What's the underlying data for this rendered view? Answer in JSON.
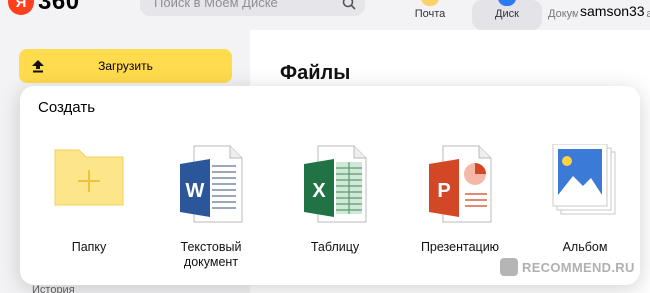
{
  "header": {
    "logo_text": "360",
    "logo_badge": "Я",
    "search_placeholder": "Поиск в Моем Диске",
    "services": [
      {
        "label": "Почта",
        "icon": "mail-icon"
      },
      {
        "label": "Диск",
        "icon": "disk-icon",
        "active": true
      },
      {
        "label": "Документы",
        "icon": "docs-icon"
      },
      {
        "label": "Ка",
        "icon": "more-icon"
      }
    ],
    "username": "samson33"
  },
  "sidebar": {
    "upload_label": "Загрузить",
    "history_label": "История"
  },
  "main": {
    "title": "Файлы"
  },
  "create_popup": {
    "title": "Создать",
    "items": [
      {
        "label": "Папку",
        "icon": "folder-icon"
      },
      {
        "label": "Текстовый документ",
        "icon": "word-document-icon"
      },
      {
        "label": "Таблицу",
        "icon": "excel-spreadsheet-icon"
      },
      {
        "label": "Презентацию",
        "icon": "powerpoint-presentation-icon"
      },
      {
        "label": "Альбом",
        "icon": "album-icon"
      }
    ]
  },
  "colors": {
    "accent_yellow": "#ffdb4d",
    "brand_red": "#fc3f1d",
    "disk_blue": "#2c7af0",
    "word_blue": "#2b579a",
    "excel_green": "#217346",
    "powerpoint_red": "#d24726"
  },
  "watermark": {
    "text": "RECOMMEND.RU"
  }
}
